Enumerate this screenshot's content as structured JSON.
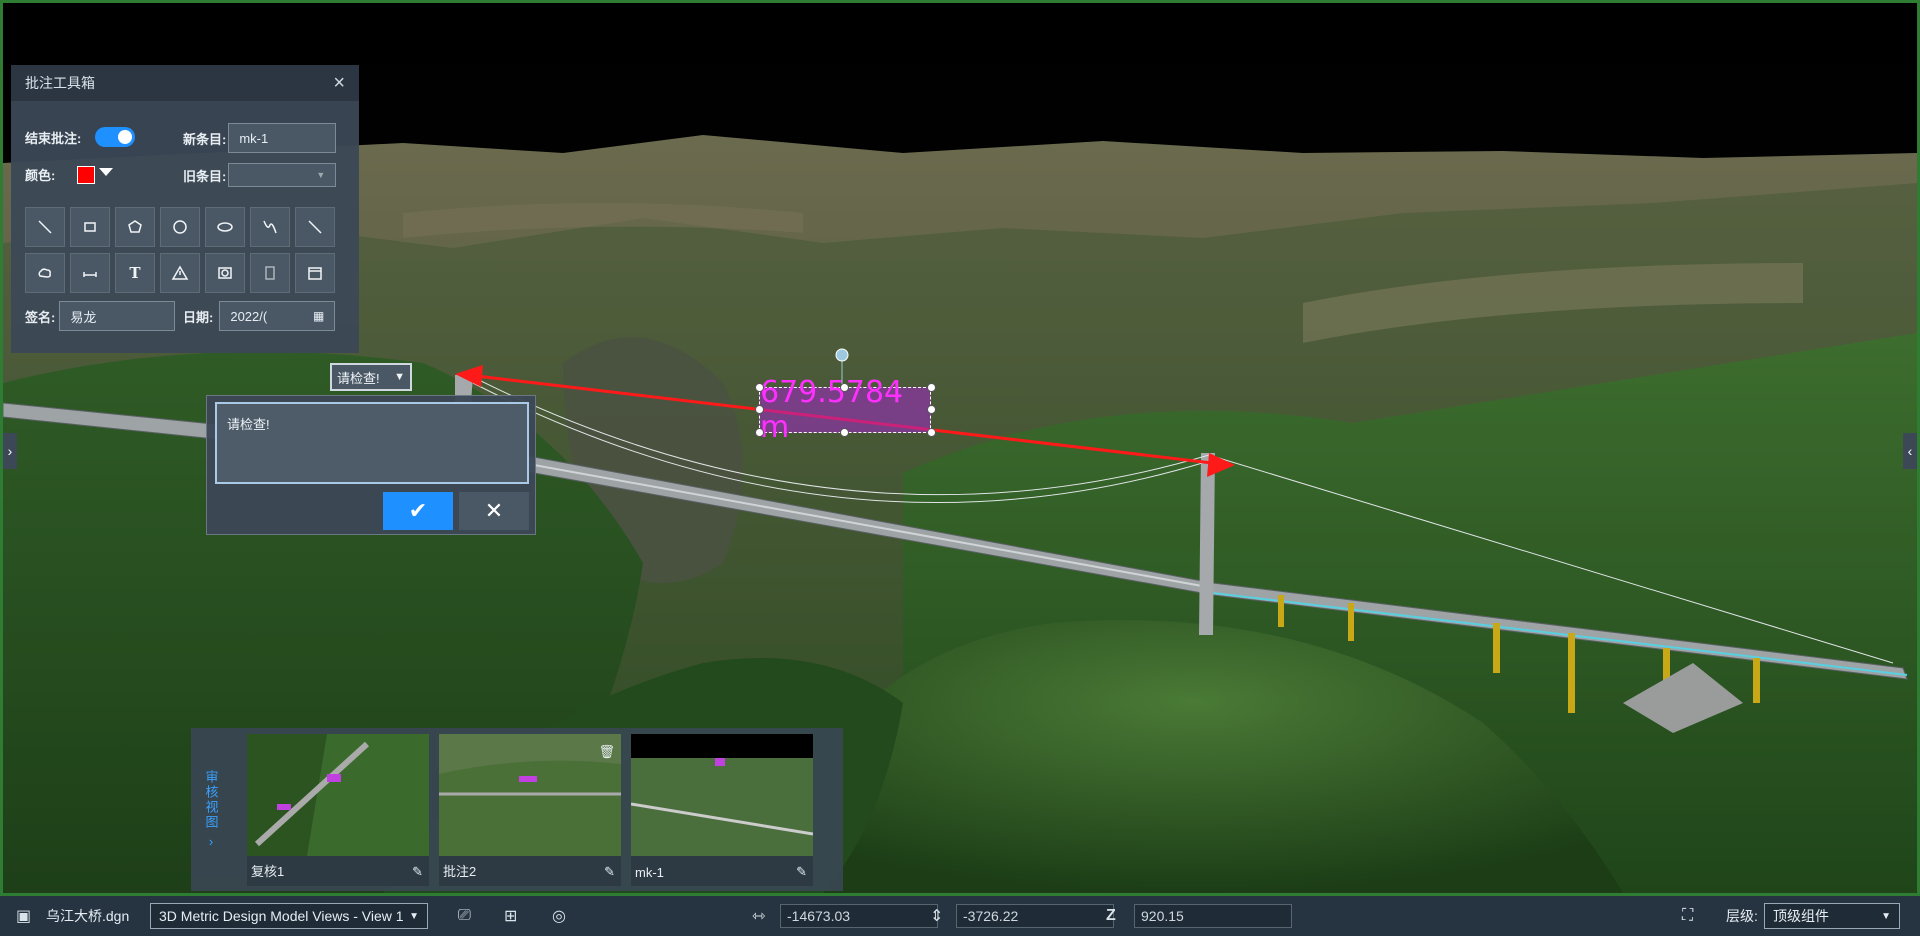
{
  "toolbox": {
    "title": "批注工具箱",
    "close_icon": "×",
    "end_annotation_label": "结束批注:",
    "new_item_label": "新条目:",
    "new_item_value": "mk-1",
    "color_label": "颜色:",
    "color_value": "#ff0000",
    "old_item_label": "旧条目:",
    "old_item_value": "",
    "signature_label": "签名:",
    "signature_value": "易龙",
    "date_label": "日期:",
    "date_value": "2022/(",
    "tools_row1": [
      "line-icon",
      "rectangle-icon",
      "pentagon-icon",
      "circle-icon",
      "ellipse-icon",
      "freehand-icon",
      "arrow-line-icon"
    ],
    "tools_row2": [
      "cloud-icon",
      "dimension-icon",
      "text-icon",
      "warning-icon",
      "image-icon",
      "stamp-icon",
      "calendar-stamp-icon"
    ],
    "text_tool_glyph": "T"
  },
  "comment": {
    "select_value": "请检查!",
    "text": "请检查!",
    "confirm_glyph": "✔",
    "cancel_glyph": "✕"
  },
  "measure": {
    "label": "679.5784 m"
  },
  "review": {
    "side_title": "审核视图",
    "side_arrow": "›",
    "views": [
      {
        "caption": "复核1"
      },
      {
        "caption": "批注2"
      },
      {
        "caption": "mk-1"
      }
    ],
    "edit_glyph": "✎",
    "delete_glyph": "🗑"
  },
  "left_tab_glyph": "›",
  "right_tab_glyph": "‹",
  "statusbar": {
    "file_name": "乌江大桥.dgn",
    "view_select": "3D Metric Design Model Views - View 1",
    "x_value": "-14673.03",
    "y_value": "-3726.22",
    "z_value": "920.15",
    "level_label": "层级:",
    "level_value": "顶级组件"
  }
}
